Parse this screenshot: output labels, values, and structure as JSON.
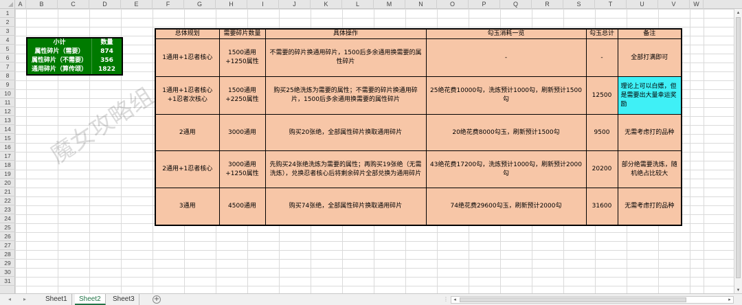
{
  "columns": [
    "A",
    "B",
    "C",
    "D",
    "E",
    "F",
    "G",
    "H",
    "I",
    "J",
    "K",
    "L",
    "M",
    "N",
    "O",
    "P",
    "Q",
    "R",
    "S",
    "T",
    "U",
    "V",
    "W"
  ],
  "rows": [
    "1",
    "2",
    "3",
    "4",
    "5",
    "6",
    "7",
    "8",
    "9",
    "10",
    "11",
    "12",
    "13",
    "14",
    "15",
    "16",
    "17",
    "18",
    "19",
    "20",
    "21",
    "22",
    "23",
    "24",
    "25",
    "26",
    "27",
    "28",
    "29",
    "30",
    "31"
  ],
  "summary": {
    "header": [
      "小计",
      "数量"
    ],
    "rows": [
      [
        "属性碎片（需要）",
        "874"
      ],
      [
        "属性碎片（不需要）",
        "356"
      ],
      [
        "通用碎片（算传颂）",
        "1822"
      ]
    ],
    "bg_color": "#007a00"
  },
  "main_table": {
    "headers": [
      "总体规划",
      "需要碎片数量",
      "具体操作",
      "勾玉消耗一览",
      "勾玉总计",
      "备注"
    ],
    "rows": [
      [
        "1通用+1忍者核心",
        "1500通用+1250属性",
        "不需要的碎片换通用碎片，1500后多余通用换需要的属性碎片",
        "-",
        "-",
        "全部打满即可"
      ],
      [
        "1通用+1忍者核心+1忍者次核心",
        "1500通用+2250属性",
        "购买25绝洗炼为需要的属性；不需要的碎片换通用碎片，1500后多余通用换需要的属性碎片",
        "25绝花费10000勾，洗炼预计1000勾，刷新预计1500勾",
        "12500",
        "理论上可以白嫖，但是需要出大量幸运奖励"
      ],
      [
        "2通用",
        "3000通用",
        "购买20张绝，全部属性碎片换取通用碎片",
        "20绝花费8000勾玉，刷新预计1500勾",
        "9500",
        "无需考虑打的品种"
      ],
      [
        "2通用+1忍者核心",
        "3000通用+1250属性",
        "先购买24张绝洗炼为需要的属性；再购买19张绝（无需洗炼），兑换忍者核心后将剩余碎片全部兑换为通用碎片",
        "43绝花费17200勾，洗炼预计1000勾，刷新预计2000勾",
        "20200",
        "部分绝需要洗炼，随机绝占比较大"
      ],
      [
        "3通用",
        "4500通用",
        "购买74张绝，全部属性碎片换取通用碎片",
        "74绝花费29600勾玉，刷新预计2000勾",
        "31600",
        "无需考虑打的品种"
      ]
    ],
    "bg_color": "#f7c6a7",
    "highlight_color": "#3ff0f6"
  },
  "watermark": "魔女攻略组",
  "sheets": [
    "Sheet1",
    "Sheet2",
    "Sheet3"
  ],
  "active_sheet": "Sheet2",
  "icons": {
    "nav_prev": "◂",
    "nav_next": "▸",
    "add_sheet": "+",
    "more": "⋮",
    "scroll_left": "◂",
    "scroll_right": "▸",
    "scroll_up": "▴",
    "scroll_down": "▾"
  }
}
